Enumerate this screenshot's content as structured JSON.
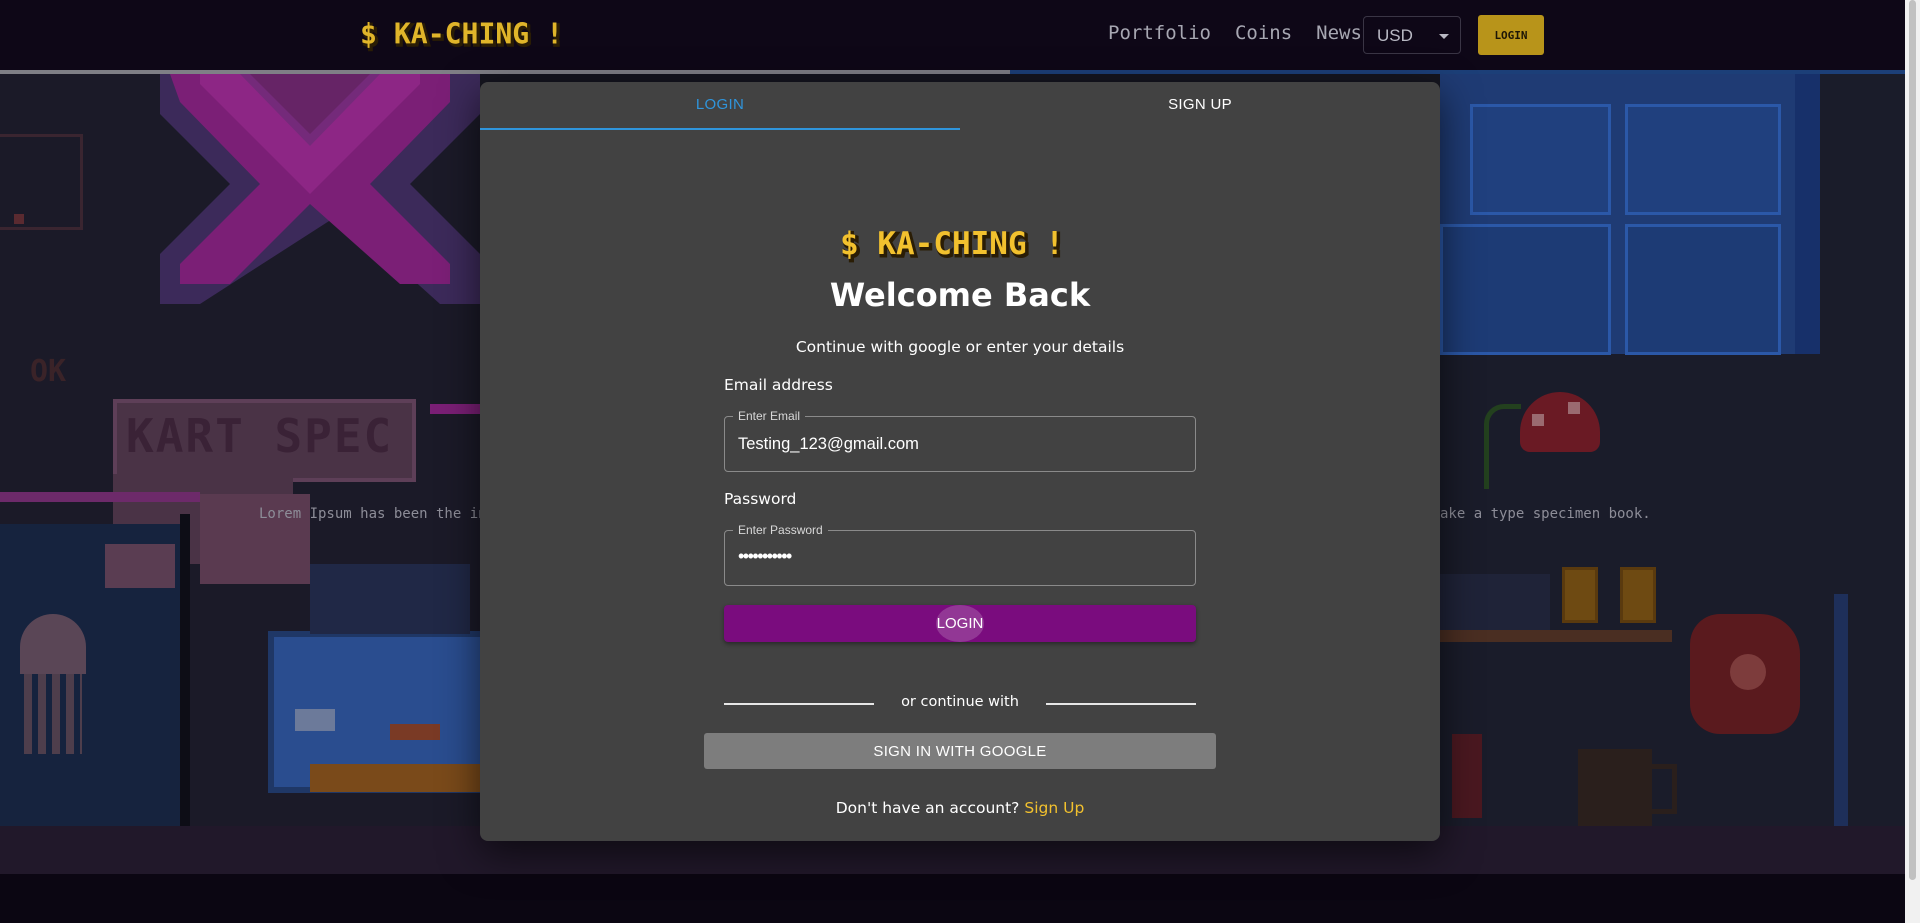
{
  "navbar": {
    "logo_text": "$ KA-CHING !",
    "links": [
      "Portfolio",
      "Coins",
      "News"
    ],
    "currency": "USD",
    "login_label": "LOGIN",
    "scroll_progress_fraction": 0.53
  },
  "hero": {
    "text_left": "Lorem Ipsum has been the in",
    "text_right": "ake a type specimen book.",
    "sign_text": "KART SPEC",
    "sign_text_2": "OK"
  },
  "modal": {
    "tabs": [
      "LOGIN",
      "SIGN UP"
    ],
    "active_tab": "LOGIN",
    "logo_text": "$ KA-CHING !",
    "title": "Welcome Back",
    "subtitle": "Continue with google or enter your details",
    "email": {
      "label": "Email address",
      "legend": "Enter Email",
      "value": "Testing_123@gmail.com"
    },
    "password": {
      "label": "Password",
      "legend": "Enter Password",
      "value": "•••••••••••"
    },
    "login_button": "LOGIN",
    "divider_text": "or continue with",
    "google_button": "SIGN IN WITH GOOGLE",
    "signup_prompt": "Don't have an account?",
    "signup_link": "Sign Up"
  },
  "colors": {
    "accent_tab": "#2f95dc",
    "login_button": "#7a0c7e",
    "brand_gold": "#f2c12e",
    "nav_login_bg": "#b8941a",
    "modal_bg": "#424242"
  }
}
